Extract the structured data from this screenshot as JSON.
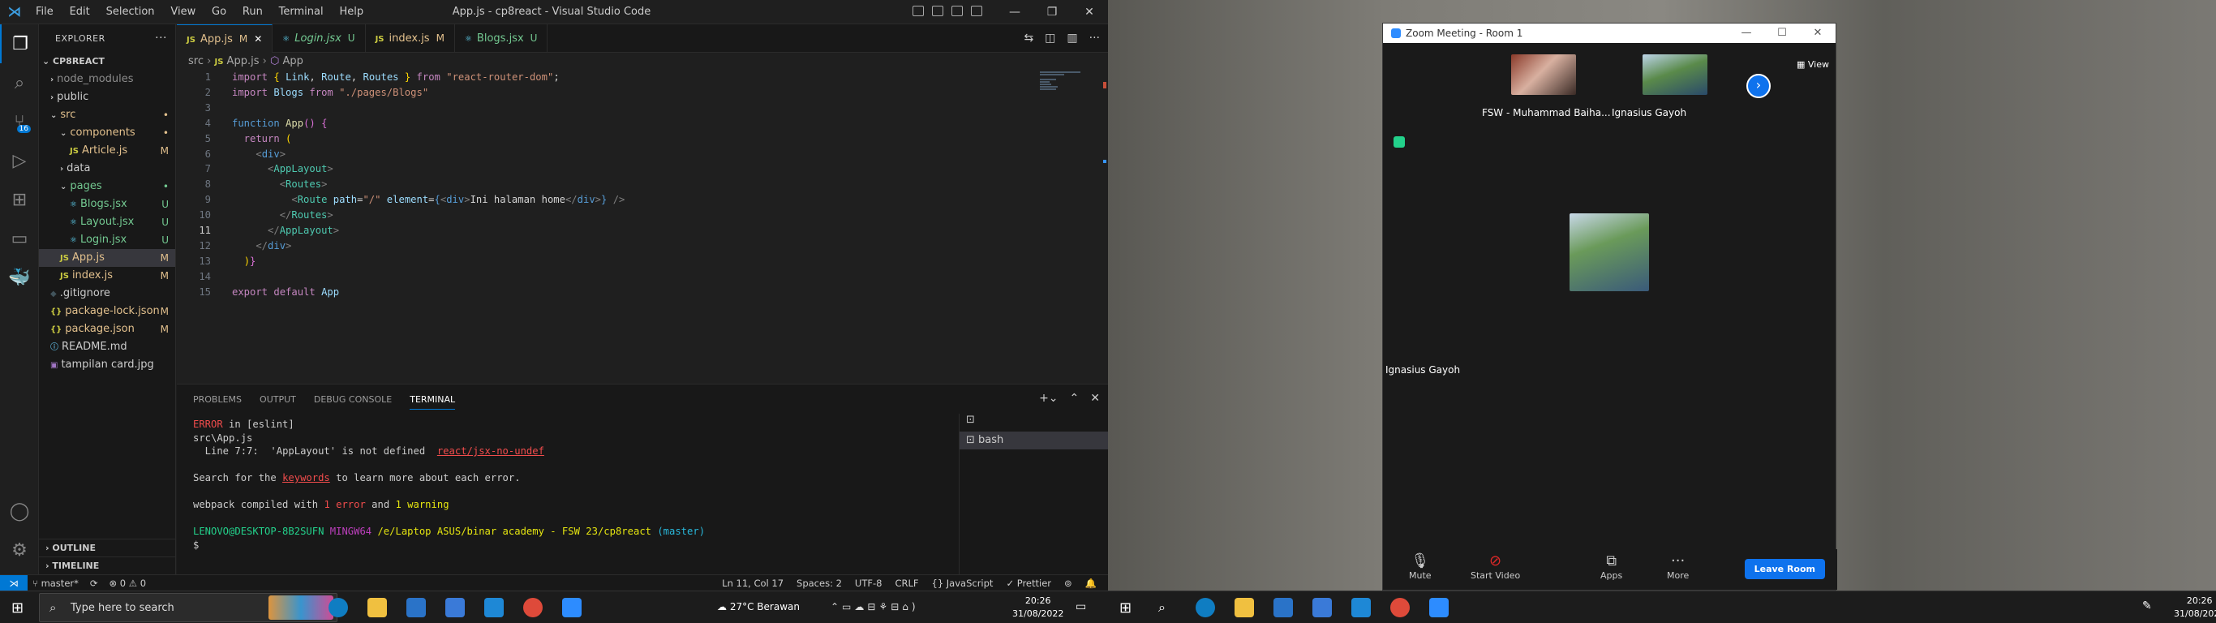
{
  "vscode": {
    "title": "App.js - cp8react - Visual Studio Code",
    "menu": [
      "File",
      "Edit",
      "Selection",
      "View",
      "Go",
      "Run",
      "Terminal",
      "Help"
    ],
    "explorer_label": "EXPLORER",
    "project": "CP8REACT",
    "tree": [
      {
        "label": "node_modules",
        "type": "folder",
        "indent": 0,
        "status": "",
        "state": "dim"
      },
      {
        "label": "public",
        "type": "folder",
        "indent": 0,
        "status": "",
        "state": ""
      },
      {
        "label": "src",
        "type": "folder-open",
        "indent": 0,
        "status": "•",
        "state": "mod"
      },
      {
        "label": "components",
        "type": "folder-open",
        "indent": 1,
        "status": "•",
        "state": "mod"
      },
      {
        "label": "Article.js",
        "type": "js",
        "indent": 2,
        "status": "M",
        "state": "mod"
      },
      {
        "label": "data",
        "type": "folder",
        "indent": 1,
        "status": "",
        "state": ""
      },
      {
        "label": "pages",
        "type": "folder-open",
        "indent": 1,
        "status": "•",
        "state": "unt"
      },
      {
        "label": "Blogs.jsx",
        "type": "jsx",
        "indent": 2,
        "status": "U",
        "state": "unt"
      },
      {
        "label": "Layout.jsx",
        "type": "jsx",
        "indent": 2,
        "status": "U",
        "state": "unt"
      },
      {
        "label": "Login.jsx",
        "type": "jsx",
        "indent": 2,
        "status": "U",
        "state": "unt"
      },
      {
        "label": "App.js",
        "type": "js",
        "indent": 1,
        "status": "M",
        "state": "mod",
        "selected": true
      },
      {
        "label": "index.js",
        "type": "js",
        "indent": 1,
        "status": "M",
        "state": "mod"
      },
      {
        "label": ".gitignore",
        "type": "git",
        "indent": 0,
        "status": "",
        "state": ""
      },
      {
        "label": "package-lock.json",
        "type": "json",
        "indent": 0,
        "status": "M",
        "state": "mod"
      },
      {
        "label": "package.json",
        "type": "json",
        "indent": 0,
        "status": "M",
        "state": "mod"
      },
      {
        "label": "README.md",
        "type": "md",
        "indent": 0,
        "status": "",
        "state": ""
      },
      {
        "label": "tampilan card.jpg",
        "type": "img",
        "indent": 0,
        "status": "",
        "state": ""
      }
    ],
    "outline_label": "OUTLINE",
    "timeline_label": "TIMELINE",
    "tabs": [
      {
        "label": "App.js",
        "status": "M",
        "active": true,
        "italic": false,
        "state": "mod"
      },
      {
        "label": "Login.jsx",
        "status": "U",
        "active": false,
        "italic": true,
        "state": "unt"
      },
      {
        "label": "index.js",
        "status": "M",
        "active": false,
        "italic": false,
        "state": "mod"
      },
      {
        "label": "Blogs.jsx",
        "status": "U",
        "active": false,
        "italic": false,
        "state": "unt"
      }
    ],
    "breadcrumb": [
      "src",
      "JS App.js",
      "App"
    ],
    "current_line": 11,
    "code_lines": [
      [
        [
          "import ",
          "kw"
        ],
        [
          "{ ",
          "bkt"
        ],
        [
          "Link",
          "var"
        ],
        [
          ", ",
          ""
        ],
        [
          "Route",
          "var"
        ],
        [
          ", ",
          ""
        ],
        [
          "Routes",
          "var"
        ],
        [
          " }",
          "bkt"
        ],
        [
          " from ",
          "kw"
        ],
        [
          "\"react-router-dom\"",
          "str"
        ],
        [
          ";",
          ""
        ]
      ],
      [
        [
          "import ",
          "kw"
        ],
        [
          "Blogs",
          "var"
        ],
        [
          " from ",
          "kw"
        ],
        [
          "\"./pages/Blogs\"",
          "str"
        ]
      ],
      [],
      [
        [
          "function ",
          "k2"
        ],
        [
          "App",
          "fn"
        ],
        [
          "() ",
          "bk2"
        ],
        [
          "{",
          "bk2"
        ]
      ],
      [
        [
          "  return ",
          "kw"
        ],
        [
          "(",
          "bkt"
        ]
      ],
      [
        [
          "    <",
          "gry"
        ],
        [
          "div",
          "tg"
        ],
        [
          ">",
          "gry"
        ]
      ],
      [
        [
          "      <",
          "gry"
        ],
        [
          "AppLayout",
          "cm"
        ],
        [
          ">",
          "gry"
        ]
      ],
      [
        [
          "        <",
          "gry"
        ],
        [
          "Routes",
          "cm"
        ],
        [
          ">",
          "gry"
        ]
      ],
      [
        [
          "          <",
          "gry"
        ],
        [
          "Route ",
          "cm"
        ],
        [
          "path",
          "var"
        ],
        [
          "=",
          ""
        ],
        [
          "\"/\"",
          "str"
        ],
        [
          " element",
          "var"
        ],
        [
          "=",
          ""
        ],
        [
          "{",
          "k2"
        ],
        [
          "<",
          "gry"
        ],
        [
          "div",
          "tg"
        ],
        [
          ">",
          "gry"
        ],
        [
          "Ini halaman home",
          ""
        ],
        [
          "</",
          "gry"
        ],
        [
          "div",
          "tg"
        ],
        [
          ">",
          "gry"
        ],
        [
          "}",
          "k2"
        ],
        [
          " />",
          "gry"
        ]
      ],
      [
        [
          "        </",
          "gry"
        ],
        [
          "Routes",
          "cm"
        ],
        [
          ">",
          "gry"
        ]
      ],
      [
        [
          "      </",
          "gry"
        ],
        [
          "AppLayout",
          "cm"
        ],
        [
          ">",
          "gry"
        ]
      ],
      [
        [
          "    </",
          "gry"
        ],
        [
          "div",
          "tg"
        ],
        [
          ">",
          "gry"
        ]
      ],
      [
        [
          "  ",
          ""
        ],
        [
          ")",
          "bkt"
        ],
        [
          "}",
          "bk2"
        ]
      ],
      [],
      [
        [
          "export ",
          "kw"
        ],
        [
          "default ",
          "kw"
        ],
        [
          "App",
          "var"
        ]
      ]
    ],
    "panel_tabs": [
      "PROBLEMS",
      "OUTPUT",
      "DEBUG CONSOLE",
      "TERMINAL"
    ],
    "terminal_lines": [
      [
        [
          "ERROR",
          "t-red"
        ],
        [
          " in [eslint]",
          ""
        ]
      ],
      [
        [
          "src\\App.js",
          ""
        ]
      ],
      [
        [
          "  Line 7:7:  ",
          ""
        ],
        [
          "'AppLayout' is not defined  ",
          ""
        ],
        [
          "react/jsx-no-undef",
          "t-red t-und"
        ]
      ],
      [],
      [
        [
          "Search for the ",
          ""
        ],
        [
          "keywords",
          "t-red t-und"
        ],
        [
          " to learn more about each error.",
          ""
        ]
      ],
      [],
      [
        [
          "webpack compiled with ",
          ""
        ],
        [
          "1 error",
          "t-red"
        ],
        [
          " and ",
          ""
        ],
        [
          "1 warning",
          "t-yel"
        ]
      ],
      [],
      [
        [
          "LENOVO@DESKTOP-8B2SUFN ",
          "t-grn"
        ],
        [
          "MINGW64 ",
          "t-mag"
        ],
        [
          "/e/Laptop ASUS/binar academy - FSW 23/cp8react",
          "t-yel"
        ],
        [
          " (master)",
          "t-cy"
        ]
      ],
      [
        [
          "$ ",
          ""
        ]
      ]
    ],
    "terminal_shell": "bash",
    "status_left": [
      "master*",
      "⊗ 0 ⚠ 0"
    ],
    "status_right": [
      "Ln 11, Col 17",
      "Spaces: 2",
      "UTF-8",
      "CRLF",
      "{} JavaScript",
      "✓ Prettier"
    ]
  },
  "zoom": {
    "title": "Zoom Meeting - Room 1",
    "view_label": "View",
    "participants": [
      "FSW - Muhammad Baiha...",
      "Ignasius Gayoh"
    ],
    "active_speaker": "Ignasius Gayoh",
    "toolbar": [
      "Mute",
      "Start Video",
      "Apps",
      "More"
    ],
    "leave": "Leave Room"
  },
  "taskbar": {
    "search_placeholder": "Type here to search",
    "weather": "27°C  Berawan",
    "time": "20:26",
    "date": "31/08/2022"
  }
}
